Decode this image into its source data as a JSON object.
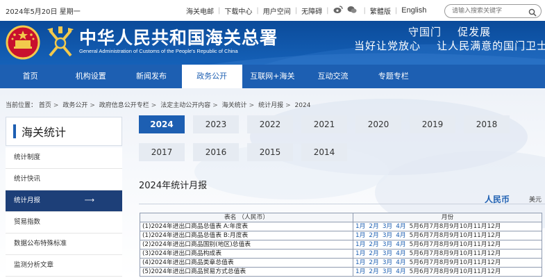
{
  "topbar": {
    "date": "2024年5月20日 星期一",
    "links": [
      "海关电邮",
      "下载中心",
      "用户空间",
      "无障碍",
      "繁體版",
      "English"
    ],
    "search_placeholder": "请输入搜索关键字"
  },
  "header": {
    "title_cn": "中华人民共和国海关总署",
    "title_en": "General Administration of Customs of the People's Republic of China",
    "slogan_line1": "守国门    促发展",
    "slogan_line2": "当好让党放心    让人民满意的国门卫士"
  },
  "nav": {
    "items": [
      "首页",
      "机构设置",
      "新闻发布",
      "政务公开",
      "互联网+海关",
      "互动交流",
      "专题专栏"
    ],
    "active_index": 3
  },
  "breadcrumb": {
    "prefix": "当前位置：",
    "items": [
      "首页",
      "政务公开",
      "政府信息公开专栏",
      "法定主动公开内容",
      "海关统计",
      "统计月报",
      "2024"
    ]
  },
  "sidebar": {
    "title": "海关统计",
    "items": [
      "统计制度",
      "统计快讯",
      "统计月报",
      "贸易指数",
      "数据公布特殊标准",
      "监测分析文章"
    ],
    "active_index": 2,
    "active_arrow": "⟶"
  },
  "years": {
    "items": [
      "2024",
      "2023",
      "2022",
      "2021",
      "2020",
      "2019",
      "2018",
      "2017",
      "2016",
      "2015",
      "2014"
    ],
    "active_index": 0
  },
  "section": {
    "title": "2024年统计月报",
    "currency_active": "人民币",
    "currency_other": "美元"
  },
  "table": {
    "headers": [
      "表名 （人民币）",
      "月份"
    ],
    "rows": [
      {
        "name": "(1)2024年进出口商品总值表 A:年度表"
      },
      {
        "name": "(1)2024年进出口商品总值表 B:月度表"
      },
      {
        "name": "(2)2024年进出口商品国别(地区)总值表"
      },
      {
        "name": "(3)2024年进出口商品构成表"
      },
      {
        "name": "(4)2024年进出口商品类章总值表"
      },
      {
        "name": "(5)2024年进出口商品贸易方式总值表"
      }
    ],
    "linked_months": [
      "1月",
      "2月",
      "3月",
      "4月"
    ],
    "plain_months": "5月6月7月8月9月10月11月12月"
  },
  "colors": {
    "brand_blue": "#1d5fb2",
    "header_blue": "#0b4b9a",
    "sidebar_active": "#1d3f78"
  }
}
